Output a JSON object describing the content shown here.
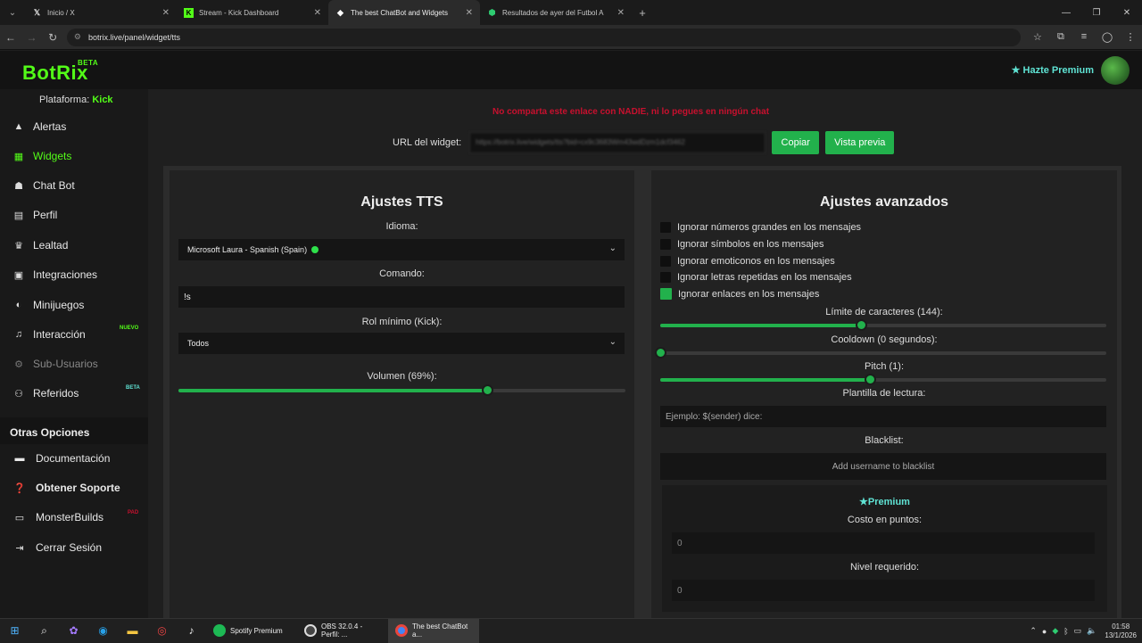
{
  "browser": {
    "tabs": [
      {
        "title": "Inicio / X",
        "icon": "x-logo-icon"
      },
      {
        "title": "Stream - Kick Dashboard",
        "icon": "kick-logo-icon"
      },
      {
        "title": "The best ChatBot and Widgets",
        "icon": "botrix-icon",
        "active": true
      },
      {
        "title": "Resultados de ayer del Futbol A",
        "icon": "soccer-icon"
      }
    ],
    "url": "botrix.live/panel/widget/tts"
  },
  "header": {
    "logo": "BotRix",
    "logo_badge": "BETA",
    "premium": "Hazte Premium"
  },
  "sidebar": {
    "platform_label": "Plataforma:",
    "platform_value": "Kick",
    "items": [
      {
        "label": "Alertas",
        "icon": "warning-icon"
      },
      {
        "label": "Widgets",
        "icon": "grid-icon",
        "active": true
      },
      {
        "label": "Chat Bot",
        "icon": "robot-icon"
      },
      {
        "label": "Perfil",
        "icon": "id-card-icon"
      },
      {
        "label": "Lealtad",
        "icon": "trophy-icon"
      },
      {
        "label": "Integraciones",
        "icon": "plug-icon"
      },
      {
        "label": "Minijuegos",
        "icon": "gamepad-icon"
      },
      {
        "label": "Interacción",
        "icon": "music-icon",
        "badge": "NUEVO"
      },
      {
        "label": "Sub-Usuarios",
        "icon": "users-icon",
        "dim": true
      },
      {
        "label": "Referidos",
        "icon": "people-icon",
        "badge": "BETA"
      }
    ],
    "other_title": "Otras Opciones",
    "other_items": [
      {
        "label": "Documentación",
        "icon": "book-icon"
      },
      {
        "label": "Obtener Soporte",
        "icon": "help-icon"
      },
      {
        "label": "MonsterBuilds",
        "icon": "monitor-icon",
        "badge": "PAD"
      },
      {
        "label": "Cerrar Sesión",
        "icon": "logout-icon"
      }
    ]
  },
  "main": {
    "warning": "No comparta este enlace con NADIE, ni lo pegues en ningún chat",
    "url_label": "URL del widget:",
    "url_value": "https://botrix.live/widgets/tts?bid=cx9c3683Wm43wdDzm1dcf3462",
    "copy_button": "Copiar",
    "preview_button": "Vista previa"
  },
  "tts": {
    "title": "Ajustes TTS",
    "language_label": "Idioma:",
    "language_value": "Microsoft Laura - Spanish (Spain)",
    "command_label": "Comando:",
    "command_value": "!s",
    "role_label": "Rol mínimo (Kick):",
    "role_value": "Todos",
    "volume_label": "Volumen (69%):",
    "volume": 0.69
  },
  "advanced": {
    "title": "Ajustes avanzados",
    "checkboxes": [
      {
        "label": "Ignorar números grandes en los mensajes",
        "checked": false
      },
      {
        "label": "Ignorar símbolos en los mensajes",
        "checked": false
      },
      {
        "label": "Ignorar emoticonos en los mensajes",
        "checked": false
      },
      {
        "label": "Ignorar letras repetidas en los mensajes",
        "checked": false
      },
      {
        "label": "Ignorar enlaces en los mensajes",
        "checked": true
      }
    ],
    "char_limit_label": "Límite de caracteres (144):",
    "char_limit": 0.45,
    "cooldown_label": "Cooldown (0 segundos):",
    "cooldown": 0,
    "pitch_label": "Pitch (1):",
    "pitch": 0.47,
    "template_label": "Plantilla de lectura:",
    "template_placeholder": "Ejemplo: $(sender) dice:",
    "blacklist_label": "Blacklist:",
    "blacklist_placeholder": "Add username to blacklist",
    "premium_title": "Premium",
    "cost_label": "Costo en puntos:",
    "cost_value": "0",
    "level_label": "Nivel requerido:",
    "level_value": "0"
  },
  "taskbar": {
    "apps": [
      {
        "label": "Spotify Premium",
        "color": "#1db954"
      },
      {
        "label": "OBS 32.0.4 - Perfil: ...",
        "color": "#444"
      },
      {
        "label": "The best ChatBot a...",
        "color": "#4285f4",
        "active": true
      }
    ],
    "time": "01:58",
    "date": "13/1/2026"
  },
  "colors": {
    "accent": "#53fc18",
    "button": "#22b14c",
    "warning": "#c8102e",
    "premium": "#5fe3d4"
  }
}
